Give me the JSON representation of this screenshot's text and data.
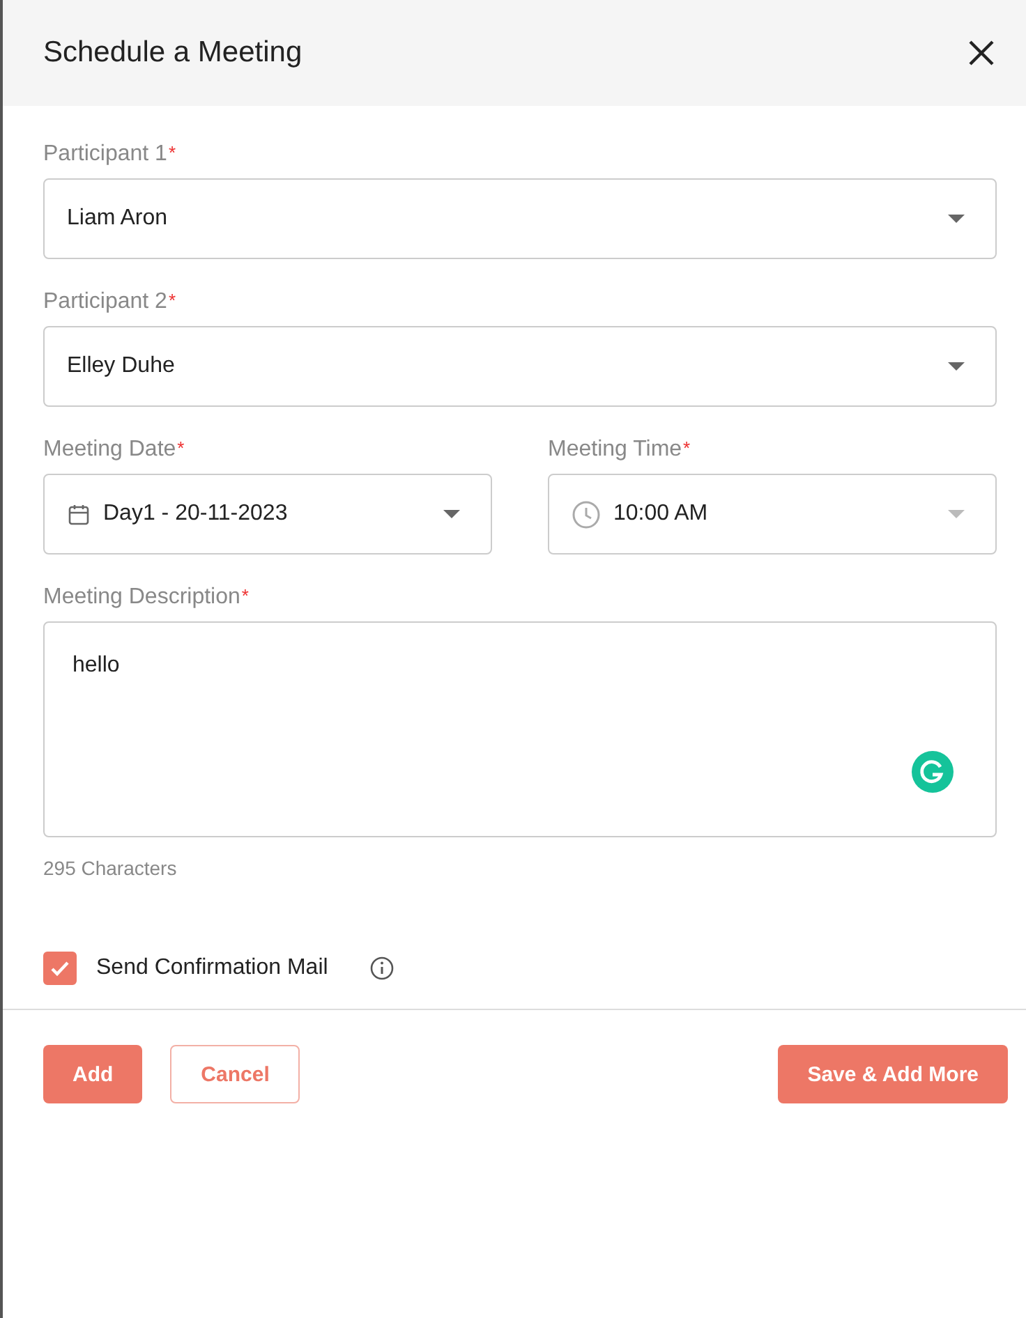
{
  "dialog": {
    "title": "Schedule a Meeting"
  },
  "fields": [
    {
      "kind": "select",
      "label": "Participant 1",
      "required": "*",
      "value": "Liam Aron"
    },
    {
      "kind": "select",
      "label": "Participant 2",
      "required": "*",
      "value": "Elley Duhe"
    },
    {
      "kind": "date",
      "label": "Meeting Date",
      "required": "*",
      "value": "Day1 - 20-11-2023"
    },
    {
      "kind": "time",
      "label": "Meeting Time",
      "required": "*",
      "value": "10:00 AM"
    }
  ],
  "description": {
    "label": "Meeting Description",
    "required": "*",
    "value": "hello",
    "counter": "295 Characters"
  },
  "confirmation": {
    "label": "Send Confirmation Mail",
    "checked": true
  },
  "buttons": [
    {
      "kind": "primary",
      "label": "Add"
    },
    {
      "kind": "outline",
      "label": "Cancel"
    },
    {
      "kind": "primary-right",
      "label": "Save & Add More"
    }
  ]
}
